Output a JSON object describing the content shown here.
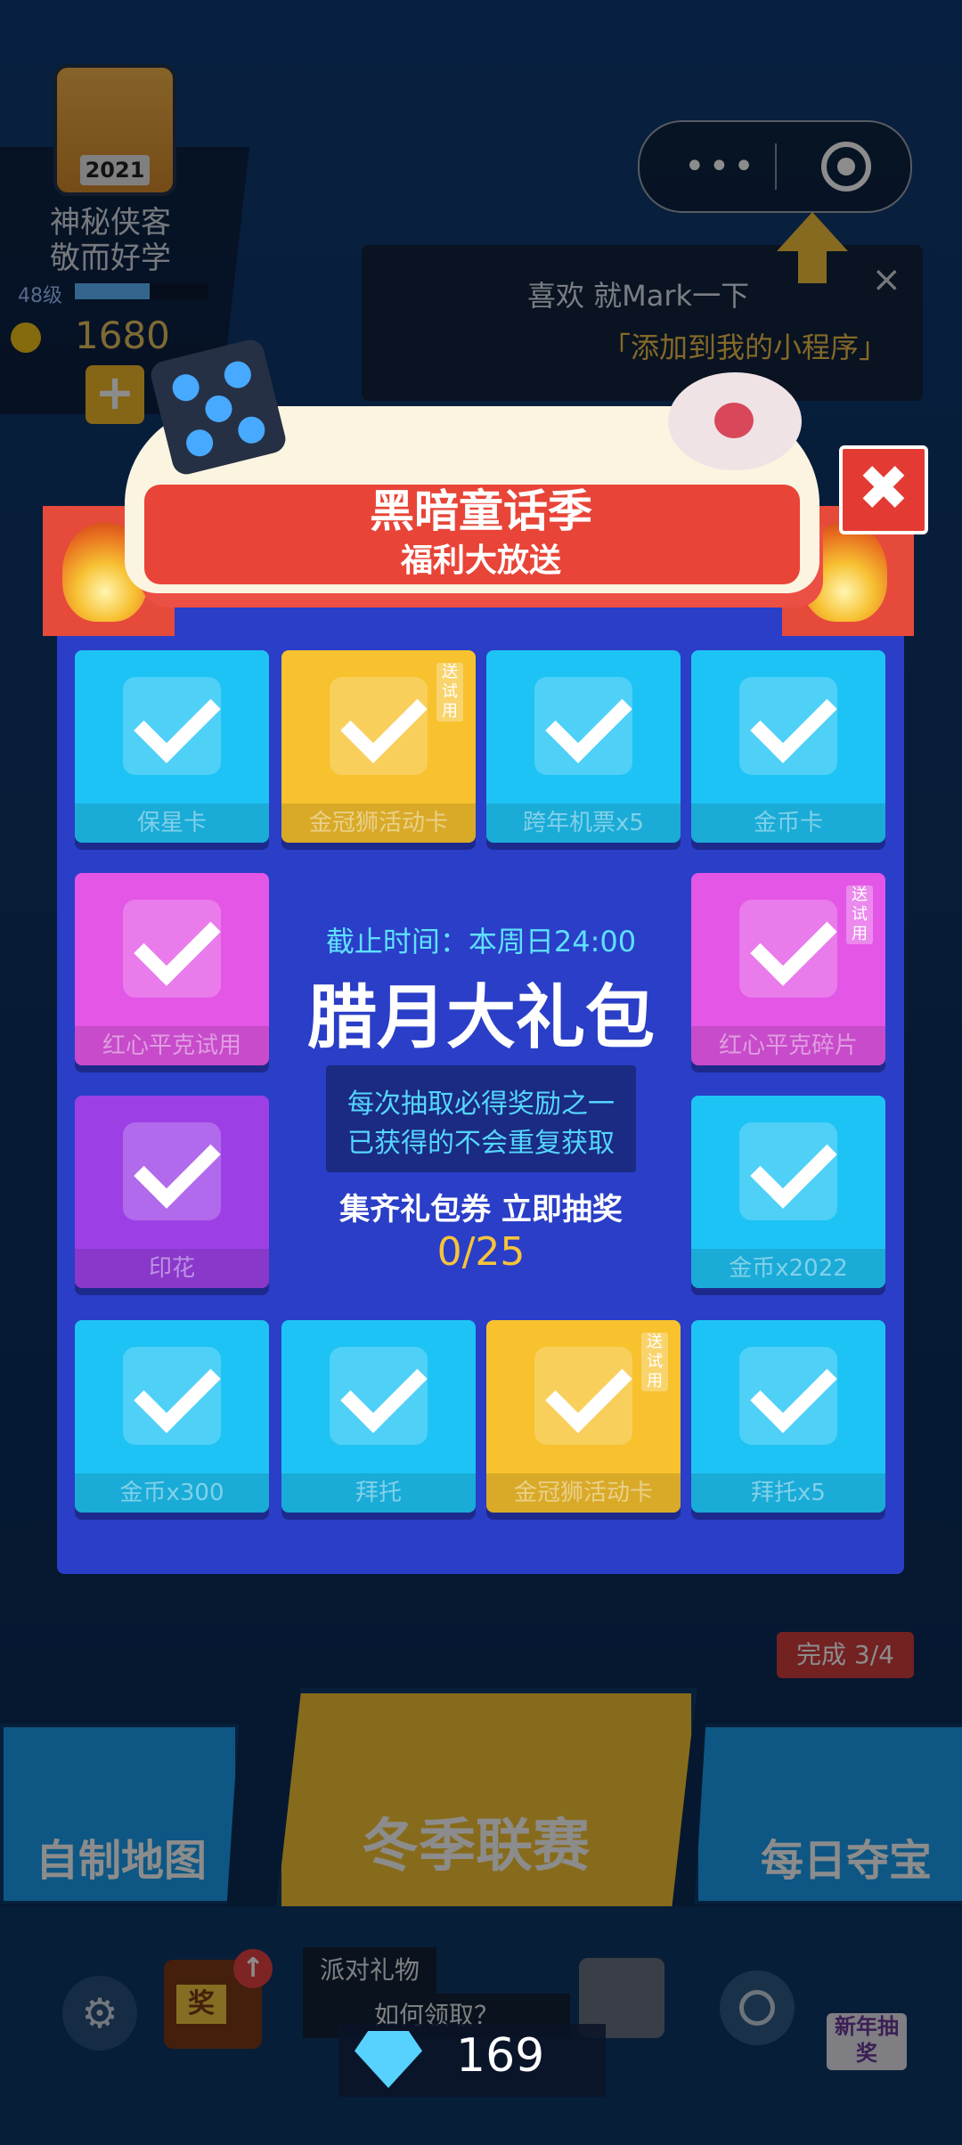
{
  "player": {
    "name": "神秘侠客",
    "title": "敬而好学",
    "level": "48级",
    "level_progress": 0.56,
    "coins": "1680",
    "avatar_tag": "2021",
    "plus_label": "+"
  },
  "mini_program": {
    "more_icon": "more-dots-icon",
    "close_icon": "target-icon"
  },
  "tip": {
    "line1": "喜欢 就Mark一下",
    "line2": "「添加到我的小程序」",
    "close": "×"
  },
  "modal": {
    "title": "黑暗童话季",
    "subtitle": "福利大放送",
    "close_label": "✖",
    "deadline": "截止时间：本周日24:00",
    "center_title": "腊月大礼包",
    "rule_line1": "每次抽取必得奖励之一",
    "rule_line2": "已获得的不会重复获取",
    "collect_text": "集齐礼包券 立即抽奖",
    "progress": "0/25",
    "trial_tag": "送试用",
    "items": [
      {
        "label": "保星卡",
        "icon": "shield-card-icon",
        "claimed": true,
        "color": "blue"
      },
      {
        "label": "金冠狮活动卡",
        "icon": "lion-costume-icon",
        "claimed": true,
        "color": "yellow",
        "trial": true
      },
      {
        "label": "跨年机票x5",
        "icon": "ticket-icon",
        "claimed": true,
        "color": "blue"
      },
      {
        "label": "金币卡",
        "icon": "coin-card-icon",
        "claimed": true,
        "color": "blue"
      },
      {
        "label": "红心平克试用",
        "icon": "pig-card-icon",
        "claimed": true,
        "color": "pink"
      },
      {
        "label": "红心平克碎片",
        "icon": "pig-card-icon",
        "claimed": true,
        "color": "pink",
        "trial": true
      },
      {
        "label": "印花",
        "icon": "stamp-icon",
        "claimed": true,
        "color": "purple"
      },
      {
        "label": "金币x2022",
        "icon": "coin-pile-icon",
        "claimed": true,
        "color": "blue"
      },
      {
        "label": "金币x300",
        "icon": "coin-pile-icon",
        "claimed": true,
        "color": "blue"
      },
      {
        "label": "拜托",
        "icon": "pray-hands-icon",
        "claimed": true,
        "color": "blue"
      },
      {
        "label": "金冠狮活动卡",
        "icon": "lion-costume-icon",
        "claimed": true,
        "color": "yellow",
        "trial": true
      },
      {
        "label": "拜托x5",
        "icon": "pray-hands-icon",
        "claimed": true,
        "color": "blue"
      }
    ]
  },
  "bottom": {
    "custom_map": "自制地图",
    "winter_league": "冬季联赛",
    "daily_treasure": "每日夺宝",
    "daily_progress": "完成 3/4",
    "tv_label": "奖",
    "gift_tip": "派对礼物",
    "howto": "如何领取？",
    "newyear": "新年抽奖",
    "gems": "169"
  },
  "colors": {
    "panel": "#2a3ec7",
    "cell_blue": "#1ec3f5",
    "cell_yellow": "#f7c22e",
    "cell_pink": "#e356e6",
    "cell_purple": "#9c40e6",
    "accent_gold": "#f7c33a",
    "ribbon_red": "#e84538"
  }
}
